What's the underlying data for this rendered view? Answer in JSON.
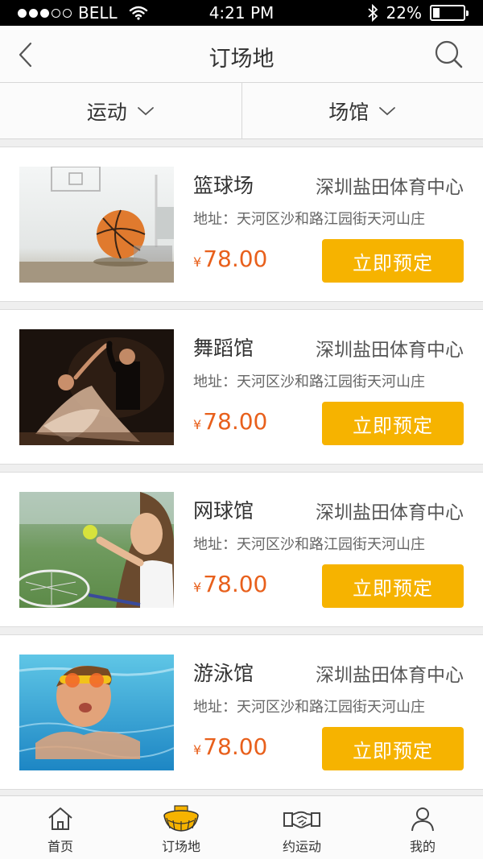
{
  "status_bar": {
    "carrier": "BELL",
    "time": "4:21 PM",
    "battery": "22%",
    "battery_level": 0.22
  },
  "nav": {
    "title": "订场地"
  },
  "filters": [
    {
      "label": "运动"
    },
    {
      "label": "场馆"
    }
  ],
  "venues": [
    {
      "name": "篮球场",
      "center": "深圳盐田体育中心",
      "address": "地址：天河区沙和路江园街天河山庄",
      "currency": "¥",
      "price": "78.00",
      "book_label": "立即预定",
      "image": "basketball-photo"
    },
    {
      "name": "舞蹈馆",
      "center": "深圳盐田体育中心",
      "address": "地址：天河区沙和路江园街天河山庄",
      "currency": "¥",
      "price": "78.00",
      "book_label": "立即预定",
      "image": "dance-photo"
    },
    {
      "name": "网球馆",
      "center": "深圳盐田体育中心",
      "address": "地址：天河区沙和路江园街天河山庄",
      "currency": "¥",
      "price": "78.00",
      "book_label": "立即预定",
      "image": "tennis-photo"
    },
    {
      "name": "游泳馆",
      "center": "深圳盐田体育中心",
      "address": "地址：天河区沙和路江园街天河山庄",
      "currency": "¥",
      "price": "78.00",
      "book_label": "立即预定",
      "image": "swimming-photo"
    }
  ],
  "tabs": [
    {
      "label": "首页",
      "icon": "home-icon"
    },
    {
      "label": "订场地",
      "icon": "stadium-icon",
      "active": true
    },
    {
      "label": "约运动",
      "icon": "handshake-icon"
    },
    {
      "label": "我的",
      "icon": "user-icon"
    }
  ],
  "colors": {
    "accent": "#f6b300",
    "price": "#e8601c"
  }
}
